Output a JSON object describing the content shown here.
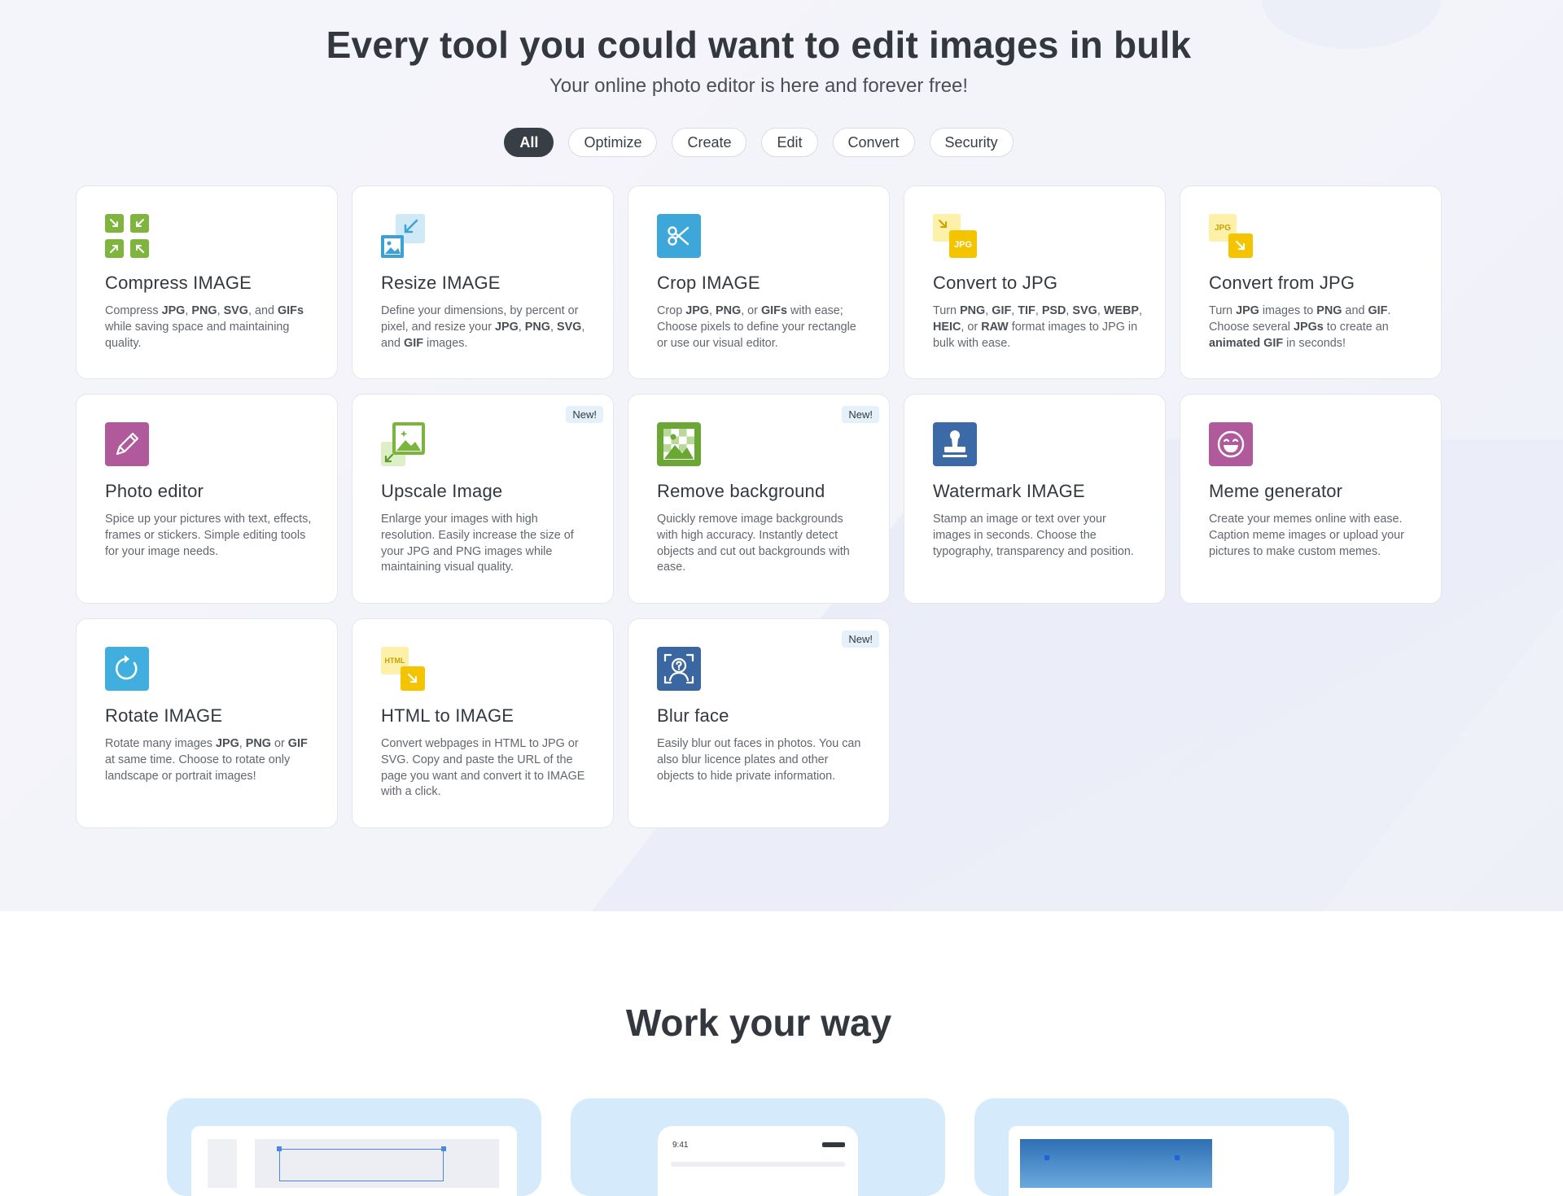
{
  "header": {
    "title": "Every tool you could want to edit images in bulk",
    "subtitle": "Your online photo editor is here and forever free!"
  },
  "filters": [
    {
      "label": "All",
      "active": true
    },
    {
      "label": "Optimize",
      "active": false
    },
    {
      "label": "Create",
      "active": false
    },
    {
      "label": "Edit",
      "active": false
    },
    {
      "label": "Convert",
      "active": false
    },
    {
      "label": "Security",
      "active": false
    }
  ],
  "tools": [
    {
      "title": "Compress IMAGE",
      "icon": "compress-icon",
      "badge": "",
      "desc": [
        "Compress ",
        {
          "b": "JPG"
        },
        ", ",
        {
          "b": "PNG"
        },
        ", ",
        {
          "b": "SVG"
        },
        ", and ",
        {
          "b": "GIFs"
        },
        " while saving space and maintaining quality."
      ]
    },
    {
      "title": "Resize IMAGE",
      "icon": "resize-icon",
      "badge": "",
      "desc": [
        "Define your dimensions, by percent or pixel, and resize your ",
        {
          "b": "JPG"
        },
        ", ",
        {
          "b": "PNG"
        },
        ", ",
        {
          "b": "SVG"
        },
        ", and ",
        {
          "b": "GIF"
        },
        " images."
      ]
    },
    {
      "title": "Crop IMAGE",
      "icon": "scissors-icon",
      "badge": "",
      "desc": [
        "Crop ",
        {
          "b": "JPG"
        },
        ", ",
        {
          "b": "PNG"
        },
        ", or ",
        {
          "b": "GIFs"
        },
        " with ease; Choose pixels to define your rectangle or use our visual editor."
      ]
    },
    {
      "title": "Convert to JPG",
      "icon": "convert-to-jpg-icon",
      "badge": "",
      "desc": [
        "Turn ",
        {
          "b": "PNG"
        },
        ", ",
        {
          "b": "GIF"
        },
        ", ",
        {
          "b": "TIF"
        },
        ", ",
        {
          "b": "PSD"
        },
        ", ",
        {
          "b": "SVG"
        },
        ", ",
        {
          "b": "WEBP"
        },
        ", ",
        {
          "b": "HEIC"
        },
        ", or ",
        {
          "b": "RAW"
        },
        " format images to JPG in bulk with ease."
      ]
    },
    {
      "title": "Convert from JPG",
      "icon": "convert-from-jpg-icon",
      "badge": "",
      "desc": [
        "Turn ",
        {
          "b": "JPG"
        },
        " images to ",
        {
          "b": "PNG"
        },
        " and ",
        {
          "b": "GIF"
        },
        ". Choose several ",
        {
          "b": "JPGs"
        },
        " to create an ",
        {
          "b": "animated GIF"
        },
        " in seconds!"
      ]
    },
    {
      "title": "Photo editor",
      "icon": "pencil-icon",
      "badge": "",
      "desc": [
        "Spice up your pictures with text, effects, frames or stickers. Simple editing tools for your image needs."
      ]
    },
    {
      "title": "Upscale Image",
      "icon": "upscale-icon",
      "badge": "New!",
      "desc": [
        "Enlarge your images with high resolution. Easily increase the size of your JPG and PNG images while maintaining visual quality."
      ]
    },
    {
      "title": "Remove background",
      "icon": "remove-background-icon",
      "badge": "New!",
      "desc": [
        "Quickly remove image backgrounds with high accuracy. Instantly detect objects and cut out backgrounds with ease."
      ]
    },
    {
      "title": "Watermark IMAGE",
      "icon": "stamp-icon",
      "badge": "",
      "desc": [
        "Stamp an image or text over your images in seconds. Choose the typography, transparency and position."
      ]
    },
    {
      "title": "Meme generator",
      "icon": "laughing-face-icon",
      "badge": "",
      "desc": [
        "Create your memes online with ease. Caption meme images or upload your pictures to make custom memes."
      ]
    },
    {
      "title": "Rotate IMAGE",
      "icon": "rotate-icon",
      "badge": "",
      "desc": [
        "Rotate many images ",
        {
          "b": "JPG"
        },
        ", ",
        {
          "b": "PNG"
        },
        " or ",
        {
          "b": "GIF"
        },
        " at same time. Choose to rotate only landscape or portrait images!"
      ]
    },
    {
      "title": "HTML to IMAGE",
      "icon": "html-to-image-icon",
      "badge": "",
      "desc": [
        "Convert webpages in HTML to JPG or SVG. Copy and paste the URL of the page you want and convert it to IMAGE with a click."
      ]
    },
    {
      "title": "Blur face",
      "icon": "blur-face-icon",
      "badge": "New!",
      "desc": [
        "Easily blur out faces in photos. You can also blur licence plates and other objects to hide private information."
      ]
    }
  ],
  "icon_labels": {
    "jpg": "JPG",
    "html": "HTML"
  },
  "work_section": {
    "title": "Work your way",
    "phone_time": "9:41"
  },
  "colors": {
    "compress": "#7fb43f",
    "resize": "#3ea1d4",
    "crop": "#3ea7d9",
    "convert": "#f5c400",
    "photo_editor": "#b05a9c",
    "upscale": "#7bb53d",
    "remove_bg": "#6aa735",
    "watermark": "#3b6aa6",
    "meme": "#b05a9c",
    "rotate": "#41aee0",
    "blur": "#3a67a1",
    "dark": "#383e45",
    "badge_bg": "#e5f1fa"
  }
}
